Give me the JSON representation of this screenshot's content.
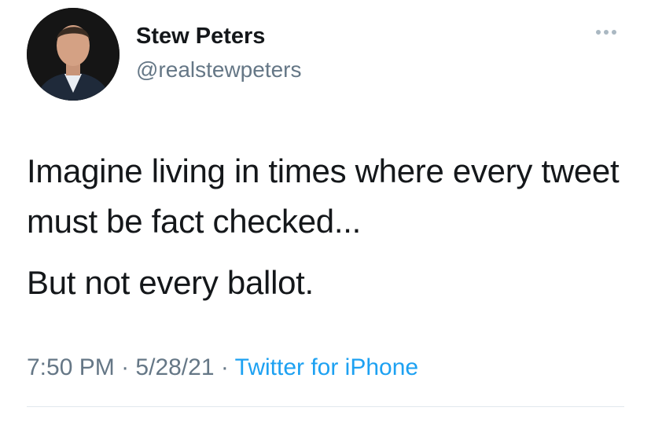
{
  "tweet": {
    "display_name": "Stew Peters",
    "handle": "@realstewpeters",
    "text_lines": [
      "Imagine living in times where every tweet must be fact checked...",
      "But not every ballot."
    ],
    "time": "7:50 PM",
    "date": "5/28/21",
    "separator": "·",
    "source": "Twitter for iPhone"
  },
  "icons": {
    "more": "more-horizontal-icon",
    "avatar": "avatar"
  },
  "colors": {
    "text": "#14171a",
    "secondary": "#657786",
    "link": "#1da1f2",
    "divider": "#e1e8ed"
  }
}
